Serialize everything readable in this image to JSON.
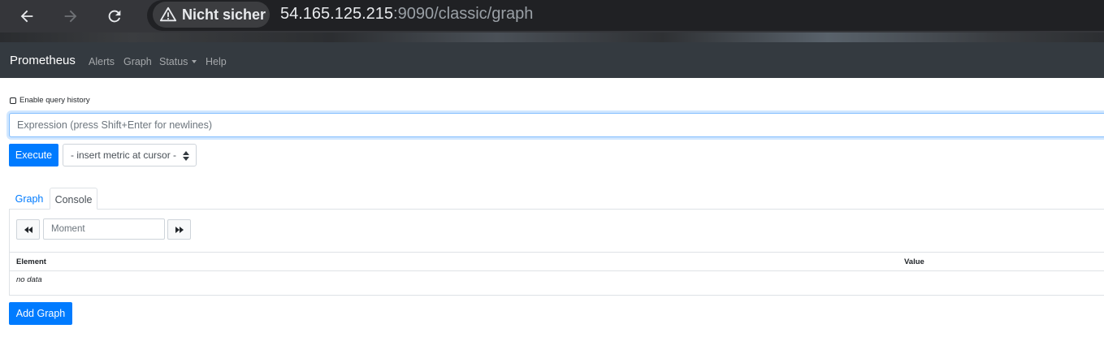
{
  "browser": {
    "security_label": "Nicht sicher",
    "url_host": "54.165.125.215",
    "url_rest": ":9090/classic/graph",
    "icons": [
      "back-arrow-icon",
      "forward-arrow-icon",
      "reload-icon",
      "warning-icon"
    ]
  },
  "navbar": {
    "brand": "Prometheus",
    "links": [
      "Alerts",
      "Graph",
      "Status",
      "Help"
    ]
  },
  "query": {
    "history_label": "Enable query history",
    "expression_placeholder": "Expression (press Shift+Enter for newlines)",
    "expression_value": "",
    "execute_label": "Execute",
    "metric_select": "- insert metric at cursor -"
  },
  "tabs": {
    "graph": "Graph",
    "console": "Console",
    "active": "Console"
  },
  "console": {
    "moment_placeholder": "Moment",
    "columns": [
      "Element",
      "Value"
    ],
    "empty_text": "no data"
  },
  "actions": {
    "add_graph": "Add Graph"
  },
  "colors": {
    "primary": "#007bff",
    "navbar_bg": "#343a40",
    "browser_bg": "#35363a"
  }
}
